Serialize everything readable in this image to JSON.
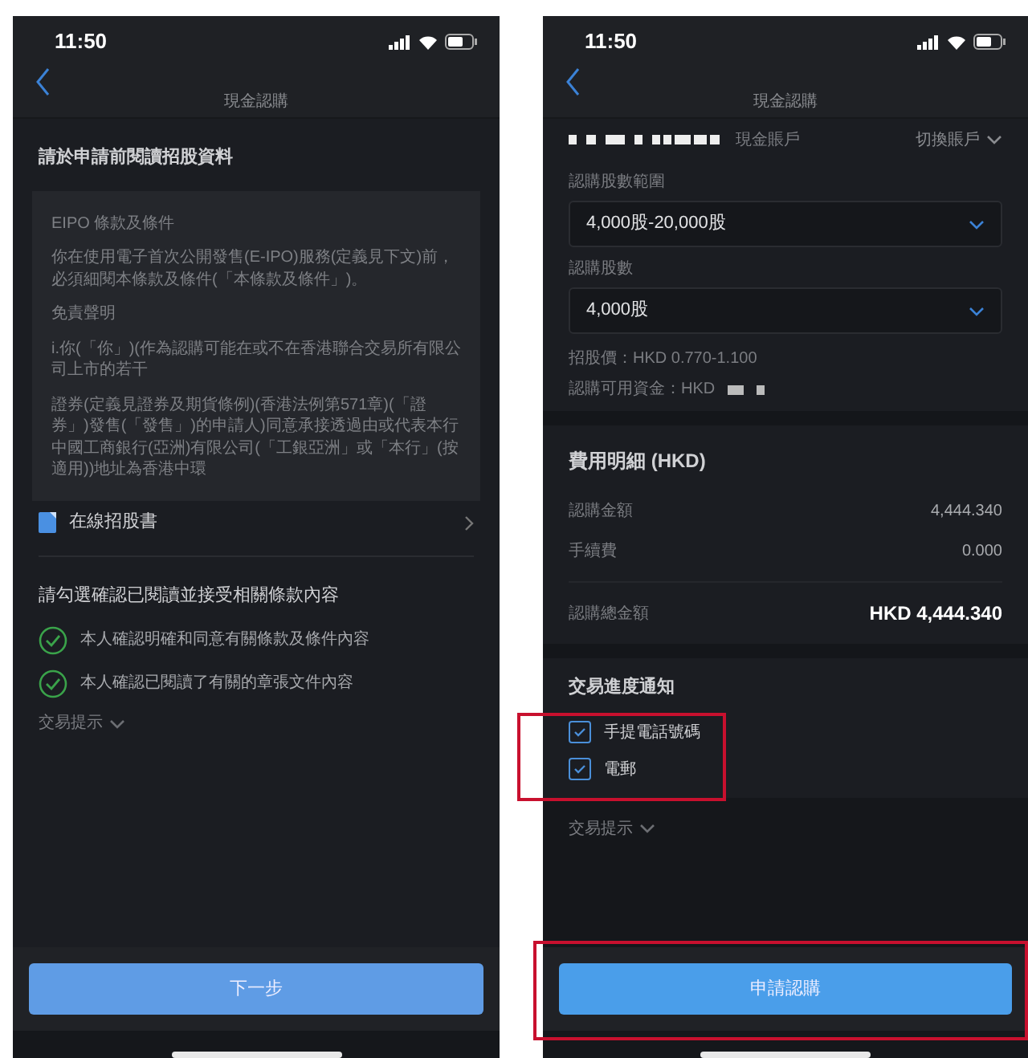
{
  "screens": [
    {
      "status_bar": {
        "time": "11:50"
      },
      "nav": {
        "title": "現金認購"
      },
      "read_section": {
        "heading": "請於申請前閱讀招股資料",
        "terms": [
          "EIPO 條款及條件",
          "你在使用電子首次公開發售(E-IPO)服務(定義見下文)前，必須細閱本條款及條件(「本條款及條件」)。",
          "免責聲明",
          "i.你(「你」)(作為認購可能在或不在香港聯合交易所有限公司上市的若干",
          "證券(定義見證券及期貨條例)(香港法例第571章)(「證券」)發售(「發售」)的申請人)同意承接透過由或代表本行中國工商銀行(亞洲)有限公司(「工銀亞洲」或「本行」(按適用))地址為香港中環"
        ],
        "link": "在線招股書"
      },
      "confirm_section": {
        "heading": "請勾選確認已閱讀並接受相關條款內容",
        "items": [
          {
            "label": "本人確認明確和同意有關條款及條件內容",
            "checked": true
          },
          {
            "label": "本人確認已閱讀了有關的章張文件內容",
            "checked": true
          }
        ],
        "tips": "交易提示"
      },
      "footer": {
        "button": "下一步",
        "highlighted": false
      }
    },
    {
      "status_bar": {
        "time": "11:50"
      },
      "nav": {
        "title": "現金認購"
      },
      "account": {
        "type": "現金賬戶",
        "switch": "切換賬戶"
      },
      "form": {
        "fields": [
          {
            "label": "認購股數範圍",
            "value": "4,000股-20,000股"
          },
          {
            "label": "認購股數",
            "value": "4,000股"
          }
        ],
        "price": "招股價：HKD 0.770-1.100",
        "funds": "認購可用資金：HKD"
      },
      "fees": {
        "heading": "費用明細 (HKD)",
        "rows": [
          {
            "label": "認購金額",
            "value": "4,444.340"
          },
          {
            "label": "手續費",
            "value": "0.000"
          }
        ],
        "total": {
          "label": "認購總金額",
          "value": "HKD 4,444.340"
        }
      },
      "notify": {
        "heading": "交易進度通知",
        "highlighted": true,
        "options": [
          {
            "label": "手提電話號碼",
            "checked": true
          },
          {
            "label": "電郵",
            "checked": true
          }
        ]
      },
      "tips": "交易提示",
      "footer": {
        "button": "申請認購",
        "highlighted": true
      }
    }
  ]
}
